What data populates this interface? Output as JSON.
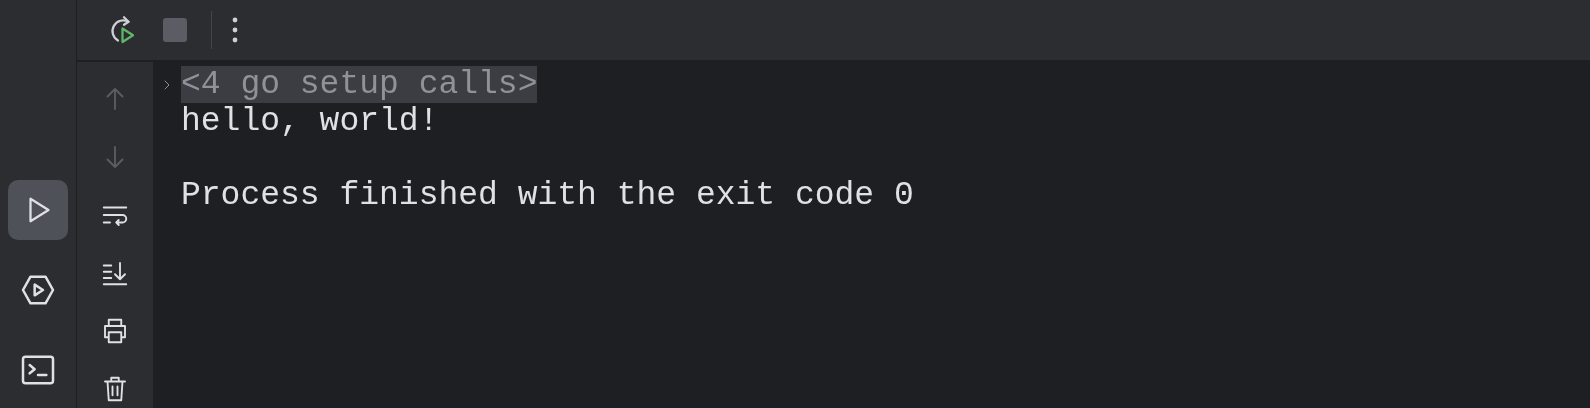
{
  "tool_strip": [
    {
      "kind": "run",
      "selected": true
    },
    {
      "kind": "services",
      "selected": false
    },
    {
      "kind": "terminal",
      "selected": false
    }
  ],
  "toolbar": [
    {
      "kind": "rerun"
    },
    {
      "kind": "stop",
      "disabled": true
    },
    {
      "kind": "more"
    }
  ],
  "side_actions": [
    {
      "kind": "up",
      "disabled": true
    },
    {
      "kind": "down",
      "disabled": true
    },
    {
      "kind": "wrap",
      "disabled": false
    },
    {
      "kind": "scroll_end",
      "disabled": false
    },
    {
      "kind": "print",
      "disabled": false
    },
    {
      "kind": "clear",
      "disabled": false
    }
  ],
  "console_blocks": [
    {
      "lines": [
        {
          "kind": "fold",
          "text": "<4 go setup calls>",
          "expanded": false
        },
        {
          "kind": "output",
          "text": "hello, world!"
        }
      ]
    },
    {
      "lines": [
        {
          "kind": "output",
          "text": "Process finished with the exit code 0"
        }
      ]
    }
  ]
}
